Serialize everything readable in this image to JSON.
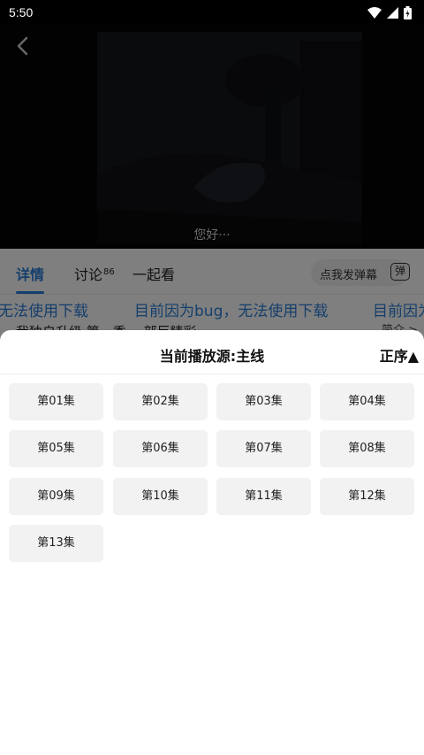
{
  "status_bar": {
    "time": "5:50"
  },
  "player": {
    "subtitle": "您好···"
  },
  "tabs": [
    {
      "label": "详情",
      "badge": ""
    },
    {
      "label": "讨论",
      "badge": "86"
    },
    {
      "label": "一起看",
      "badge": ""
    }
  ],
  "danmu": {
    "placeholder": "点我发弹幕",
    "icon_text": "弹"
  },
  "announcement": {
    "texts": [
      "无法使用下载",
      "目前因为bug，无法使用下载",
      "目前因为"
    ]
  },
  "background": {
    "title_partial": "我独自升级 第一季 一部巨精彩",
    "intro_link": "简介 >"
  },
  "episode_sheet": {
    "title": "当前播放源:主线",
    "sort_label": "正序▲",
    "episodes": [
      "第01集",
      "第02集",
      "第03集",
      "第04集",
      "第05集",
      "第06集",
      "第07集",
      "第08集",
      "第09集",
      "第10集",
      "第11集",
      "第12集",
      "第13集"
    ]
  },
  "colors": {
    "accent": "#2a7fd8",
    "episode_bg": "#f2f2f2",
    "overlay": "rgba(0,0,0,0.5)"
  }
}
